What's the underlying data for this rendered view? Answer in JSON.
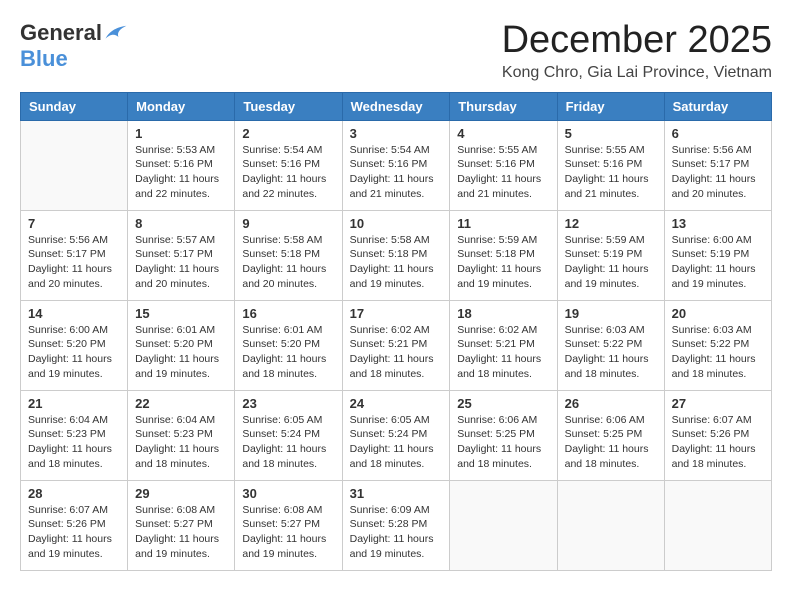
{
  "logo": {
    "general": "General",
    "blue": "Blue"
  },
  "header": {
    "month": "December 2025",
    "location": "Kong Chro, Gia Lai Province, Vietnam"
  },
  "weekdays": [
    "Sunday",
    "Monday",
    "Tuesday",
    "Wednesday",
    "Thursday",
    "Friday",
    "Saturday"
  ],
  "weeks": [
    [
      {
        "day": null,
        "info": null
      },
      {
        "day": "1",
        "sunrise": "5:53 AM",
        "sunset": "5:16 PM",
        "daylight": "11 hours and 22 minutes."
      },
      {
        "day": "2",
        "sunrise": "5:54 AM",
        "sunset": "5:16 PM",
        "daylight": "11 hours and 22 minutes."
      },
      {
        "day": "3",
        "sunrise": "5:54 AM",
        "sunset": "5:16 PM",
        "daylight": "11 hours and 21 minutes."
      },
      {
        "day": "4",
        "sunrise": "5:55 AM",
        "sunset": "5:16 PM",
        "daylight": "11 hours and 21 minutes."
      },
      {
        "day": "5",
        "sunrise": "5:55 AM",
        "sunset": "5:16 PM",
        "daylight": "11 hours and 21 minutes."
      },
      {
        "day": "6",
        "sunrise": "5:56 AM",
        "sunset": "5:17 PM",
        "daylight": "11 hours and 20 minutes."
      }
    ],
    [
      {
        "day": "7",
        "sunrise": "5:56 AM",
        "sunset": "5:17 PM",
        "daylight": "11 hours and 20 minutes."
      },
      {
        "day": "8",
        "sunrise": "5:57 AM",
        "sunset": "5:17 PM",
        "daylight": "11 hours and 20 minutes."
      },
      {
        "day": "9",
        "sunrise": "5:58 AM",
        "sunset": "5:18 PM",
        "daylight": "11 hours and 20 minutes."
      },
      {
        "day": "10",
        "sunrise": "5:58 AM",
        "sunset": "5:18 PM",
        "daylight": "11 hours and 19 minutes."
      },
      {
        "day": "11",
        "sunrise": "5:59 AM",
        "sunset": "5:18 PM",
        "daylight": "11 hours and 19 minutes."
      },
      {
        "day": "12",
        "sunrise": "5:59 AM",
        "sunset": "5:19 PM",
        "daylight": "11 hours and 19 minutes."
      },
      {
        "day": "13",
        "sunrise": "6:00 AM",
        "sunset": "5:19 PM",
        "daylight": "11 hours and 19 minutes."
      }
    ],
    [
      {
        "day": "14",
        "sunrise": "6:00 AM",
        "sunset": "5:20 PM",
        "daylight": "11 hours and 19 minutes."
      },
      {
        "day": "15",
        "sunrise": "6:01 AM",
        "sunset": "5:20 PM",
        "daylight": "11 hours and 19 minutes."
      },
      {
        "day": "16",
        "sunrise": "6:01 AM",
        "sunset": "5:20 PM",
        "daylight": "11 hours and 18 minutes."
      },
      {
        "day": "17",
        "sunrise": "6:02 AM",
        "sunset": "5:21 PM",
        "daylight": "11 hours and 18 minutes."
      },
      {
        "day": "18",
        "sunrise": "6:02 AM",
        "sunset": "5:21 PM",
        "daylight": "11 hours and 18 minutes."
      },
      {
        "day": "19",
        "sunrise": "6:03 AM",
        "sunset": "5:22 PM",
        "daylight": "11 hours and 18 minutes."
      },
      {
        "day": "20",
        "sunrise": "6:03 AM",
        "sunset": "5:22 PM",
        "daylight": "11 hours and 18 minutes."
      }
    ],
    [
      {
        "day": "21",
        "sunrise": "6:04 AM",
        "sunset": "5:23 PM",
        "daylight": "11 hours and 18 minutes."
      },
      {
        "day": "22",
        "sunrise": "6:04 AM",
        "sunset": "5:23 PM",
        "daylight": "11 hours and 18 minutes."
      },
      {
        "day": "23",
        "sunrise": "6:05 AM",
        "sunset": "5:24 PM",
        "daylight": "11 hours and 18 minutes."
      },
      {
        "day": "24",
        "sunrise": "6:05 AM",
        "sunset": "5:24 PM",
        "daylight": "11 hours and 18 minutes."
      },
      {
        "day": "25",
        "sunrise": "6:06 AM",
        "sunset": "5:25 PM",
        "daylight": "11 hours and 18 minutes."
      },
      {
        "day": "26",
        "sunrise": "6:06 AM",
        "sunset": "5:25 PM",
        "daylight": "11 hours and 18 minutes."
      },
      {
        "day": "27",
        "sunrise": "6:07 AM",
        "sunset": "5:26 PM",
        "daylight": "11 hours and 18 minutes."
      }
    ],
    [
      {
        "day": "28",
        "sunrise": "6:07 AM",
        "sunset": "5:26 PM",
        "daylight": "11 hours and 19 minutes."
      },
      {
        "day": "29",
        "sunrise": "6:08 AM",
        "sunset": "5:27 PM",
        "daylight": "11 hours and 19 minutes."
      },
      {
        "day": "30",
        "sunrise": "6:08 AM",
        "sunset": "5:27 PM",
        "daylight": "11 hours and 19 minutes."
      },
      {
        "day": "31",
        "sunrise": "6:09 AM",
        "sunset": "5:28 PM",
        "daylight": "11 hours and 19 minutes."
      },
      {
        "day": null,
        "info": null
      },
      {
        "day": null,
        "info": null
      },
      {
        "day": null,
        "info": null
      }
    ]
  ],
  "labels": {
    "sunrise_prefix": "Sunrise: ",
    "sunset_prefix": "Sunset: ",
    "daylight_label": "Daylight: "
  }
}
